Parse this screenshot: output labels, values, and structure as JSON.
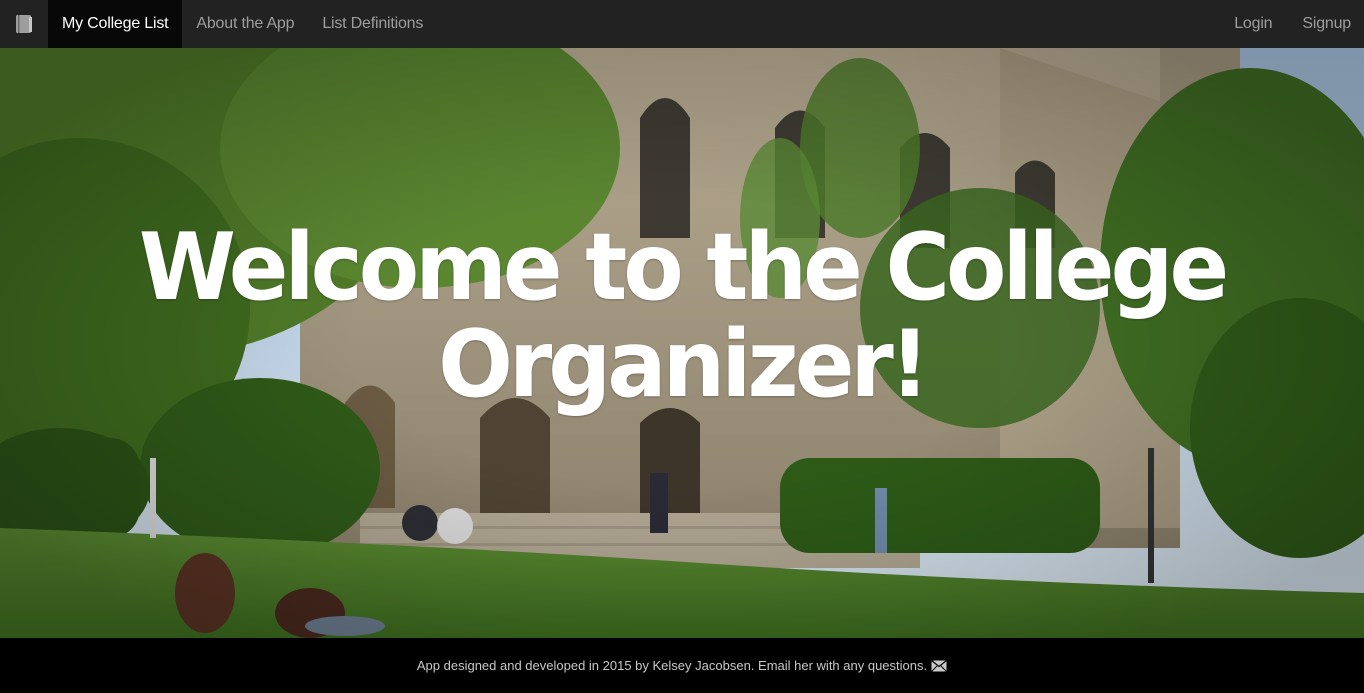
{
  "navbar": {
    "brand_icon": "book-icon",
    "items": [
      {
        "label": "My College List",
        "active": true
      },
      {
        "label": "About the App",
        "active": false
      },
      {
        "label": "List Definitions",
        "active": false
      }
    ],
    "right_items": [
      {
        "label": "Login"
      },
      {
        "label": "Signup"
      }
    ]
  },
  "hero": {
    "title": "Welcome to the College Organizer!"
  },
  "footer": {
    "text": "App designed and developed in 2015 by Kelsey Jacobsen. Email her with any questions.",
    "mail_icon": "envelope-icon"
  },
  "colors": {
    "navbar_bg": "#222222",
    "nav_active_bg": "#080808",
    "nav_text": "#9d9d9d",
    "footer_bg": "#000000"
  }
}
